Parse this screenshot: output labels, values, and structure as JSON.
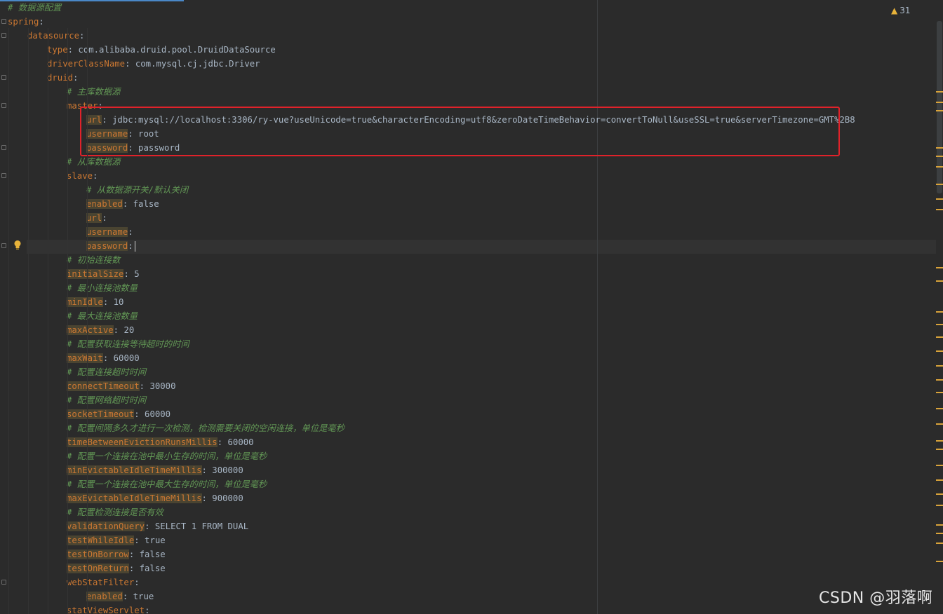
{
  "inspection": {
    "warning_count": "31"
  },
  "watermark": "CSDN @羽落啊",
  "lines": [
    {
      "indent": 0,
      "type": "comment",
      "text": "# 数据源配置",
      "fold": false
    },
    {
      "indent": 0,
      "type": "kv",
      "key": "spring",
      "value": "",
      "fold": true
    },
    {
      "indent": 1,
      "type": "kv",
      "key": "datasource",
      "value": "",
      "fold": true
    },
    {
      "indent": 2,
      "type": "kv",
      "key": "type",
      "value": "com.alibaba.druid.pool.DruidDataSource"
    },
    {
      "indent": 2,
      "type": "kv",
      "key": "driverClassName",
      "value": "com.mysql.cj.jdbc.Driver"
    },
    {
      "indent": 2,
      "type": "kv",
      "key": "druid",
      "value": "",
      "fold": true
    },
    {
      "indent": 3,
      "type": "comment",
      "text": "# 主库数据源"
    },
    {
      "indent": 3,
      "type": "kv",
      "key": "master",
      "value": "",
      "fold": true
    },
    {
      "indent": 4,
      "type": "kv",
      "key": "url",
      "value": "jdbc:mysql://localhost:3306/ry-vue?useUnicode=true&characterEncoding=utf8&zeroDateTimeBehavior=convertToNull&useSSL=true&serverTimezone=GMT%2B8",
      "hl": true
    },
    {
      "indent": 4,
      "type": "kv",
      "key": "username",
      "value": "root",
      "hl": true
    },
    {
      "indent": 4,
      "type": "kv",
      "key": "password",
      "value": "password",
      "hl": true,
      "fold": true
    },
    {
      "indent": 3,
      "type": "comment",
      "text": "# 从库数据源"
    },
    {
      "indent": 3,
      "type": "kv",
      "key": "slave",
      "value": "",
      "fold": true
    },
    {
      "indent": 4,
      "type": "comment",
      "text": "# 从数据源开关/默认关闭"
    },
    {
      "indent": 4,
      "type": "kv",
      "key": "enabled",
      "value": "false",
      "hl": true
    },
    {
      "indent": 4,
      "type": "kv",
      "key": "url",
      "value": "",
      "hl": true
    },
    {
      "indent": 4,
      "type": "kv",
      "key": "username",
      "value": "",
      "hl": true
    },
    {
      "indent": 4,
      "type": "kv",
      "key": "password",
      "value": "",
      "hl": true,
      "caret": true,
      "fold": true
    },
    {
      "indent": 3,
      "type": "comment",
      "text": "# 初始连接数"
    },
    {
      "indent": 3,
      "type": "kv",
      "key": "initialSize",
      "value": "5",
      "hl": true
    },
    {
      "indent": 3,
      "type": "comment",
      "text": "# 最小连接池数量"
    },
    {
      "indent": 3,
      "type": "kv",
      "key": "minIdle",
      "value": "10",
      "hl": true
    },
    {
      "indent": 3,
      "type": "comment",
      "text": "# 最大连接池数量"
    },
    {
      "indent": 3,
      "type": "kv",
      "key": "maxActive",
      "value": "20",
      "hl": true
    },
    {
      "indent": 3,
      "type": "comment",
      "text": "# 配置获取连接等待超时的时间"
    },
    {
      "indent": 3,
      "type": "kv",
      "key": "maxWait",
      "value": "60000",
      "hl": true
    },
    {
      "indent": 3,
      "type": "comment",
      "text": "# 配置连接超时时间"
    },
    {
      "indent": 3,
      "type": "kv",
      "key": "connectTimeout",
      "value": "30000",
      "hl": true
    },
    {
      "indent": 3,
      "type": "comment",
      "text": "# 配置网络超时时间"
    },
    {
      "indent": 3,
      "type": "kv",
      "key": "socketTimeout",
      "value": "60000",
      "hl": true
    },
    {
      "indent": 3,
      "type": "comment",
      "text": "# 配置间隔多久才进行一次检测，检测需要关闭的空闲连接，单位是毫秒"
    },
    {
      "indent": 3,
      "type": "kv",
      "key": "timeBetweenEvictionRunsMillis",
      "value": "60000",
      "hl": true
    },
    {
      "indent": 3,
      "type": "comment",
      "text": "# 配置一个连接在池中最小生存的时间，单位是毫秒"
    },
    {
      "indent": 3,
      "type": "kv",
      "key": "minEvictableIdleTimeMillis",
      "value": "300000",
      "hl": true
    },
    {
      "indent": 3,
      "type": "comment",
      "text": "# 配置一个连接在池中最大生存的时间，单位是毫秒"
    },
    {
      "indent": 3,
      "type": "kv",
      "key": "maxEvictableIdleTimeMillis",
      "value": "900000",
      "hl": true
    },
    {
      "indent": 3,
      "type": "comment",
      "text": "# 配置检测连接是否有效"
    },
    {
      "indent": 3,
      "type": "kv",
      "key": "validationQuery",
      "value": "SELECT 1 FROM DUAL",
      "hl": true
    },
    {
      "indent": 3,
      "type": "kv",
      "key": "testWhileIdle",
      "value": "true",
      "hl": true
    },
    {
      "indent": 3,
      "type": "kv",
      "key": "testOnBorrow",
      "value": "false",
      "hl": true
    },
    {
      "indent": 3,
      "type": "kv",
      "key": "testOnReturn",
      "value": "false",
      "hl": true
    },
    {
      "indent": 3,
      "type": "kv",
      "key": "webStatFilter",
      "value": "",
      "fold": true
    },
    {
      "indent": 4,
      "type": "kv",
      "key": "enabled",
      "value": "true",
      "hl": true
    },
    {
      "indent": 3,
      "type": "kv",
      "key": "statViewServlet",
      "value": ""
    }
  ],
  "colors": {
    "background": "#2b2b2b",
    "key": "#cc7832",
    "comment": "#629755",
    "value": "#a9b7c6",
    "highlight_box": "#e0222a",
    "warning": "#e8b33a"
  }
}
